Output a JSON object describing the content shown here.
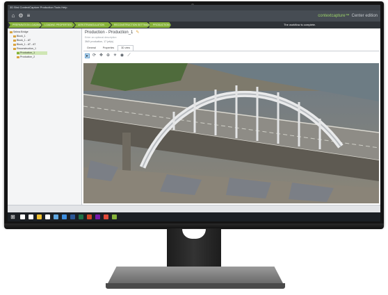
{
  "window": {
    "title": "3D Bird ContextCapture Production Tools Help"
  },
  "toolbar": {
    "icons": [
      "home-icon",
      "settings-icon",
      "menu-icon"
    ]
  },
  "brand": {
    "name": "contextcapture™",
    "edition": "Center edition"
  },
  "workflow": {
    "steps": [
      "PREPARATION LOADING",
      "LOADING PROPERTIES",
      "AEROTRIANGULATION",
      "RECONSTRUCTION SETTINGS",
      "PRODUCTION"
    ],
    "status": "The workflow is complete."
  },
  "tree": {
    "items": [
      {
        "label": "Selma Bridge",
        "level": 0
      },
      {
        "label": "Block_1",
        "level": 1
      },
      {
        "label": "Block_1 - AT",
        "level": 1
      },
      {
        "label": "Block_1 - AT - AT",
        "level": 1
      },
      {
        "label": "Reconstruction_1",
        "level": 1
      },
      {
        "label": "Production_1",
        "level": 2,
        "selected": true
      },
      {
        "label": "Production_2",
        "level": 2
      }
    ]
  },
  "production": {
    "title": "Production - Production_1",
    "description": "Enter an optional description",
    "summary": "3MX production, 17 job(s)"
  },
  "tabs": [
    "General",
    "Properties",
    "3D view"
  ],
  "active_tab": "3D view",
  "view_toolbar": {
    "buttons": [
      "select-icon",
      "orbit-icon",
      "pan-icon",
      "zoom-icon",
      "light-icon",
      "camera-icon",
      "measure-icon"
    ]
  },
  "taskbar": {
    "apps": [
      "search-icon",
      "task-view-icon",
      "explorer-icon",
      "store-icon",
      "mail-icon",
      "edge-icon",
      "word-icon",
      "excel-icon",
      "powerpoint-icon",
      "onenote-icon",
      "chrome-icon",
      "contextcapture-icon"
    ],
    "colors": [
      "#ffffff",
      "#ffffff",
      "#f1c232",
      "#ffffff",
      "#5ea6e0",
      "#3c8dde",
      "#2b5797",
      "#1e7145",
      "#d24726",
      "#7719aa",
      "#e04a3a",
      "#86b23a"
    ]
  },
  "colors": {
    "accent": "#86b23a",
    "toolbar": "#464c53",
    "taskbar": "#1b1f24"
  }
}
